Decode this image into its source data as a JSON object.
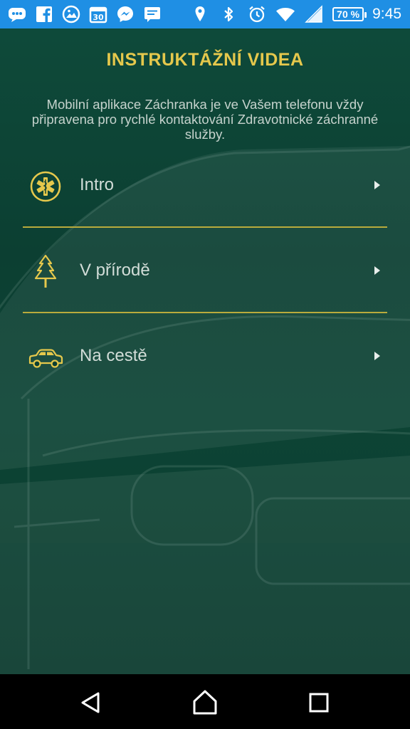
{
  "status_bar": {
    "notification_icons": [
      "chat-bubble-icon",
      "facebook-icon",
      "gallery-icon",
      "calendar-icon",
      "messenger-icon",
      "message-icon"
    ],
    "calendar_day": "30",
    "system_icons": [
      "location-icon",
      "bluetooth-icon",
      "alarm-icon",
      "wifi-icon",
      "signal-icon"
    ],
    "battery": "70 %",
    "time": "9:45"
  },
  "page": {
    "title": "INSTRUKTÁŽNÍ VIDEA",
    "subtitle": "Mobilní aplikace Záchranka je ve Vašem telefonu vždy připravena pro rychlé kontaktování Zdravotnické záchranné služby."
  },
  "menu": {
    "items": [
      {
        "label": "Intro",
        "icon": "star-of-life-icon"
      },
      {
        "label": "V přírodě",
        "icon": "tree-icon"
      },
      {
        "label": "Na cestě",
        "icon": "car-icon"
      }
    ]
  },
  "nav_bar": {
    "buttons": [
      "back-icon",
      "home-icon",
      "recents-icon"
    ]
  },
  "colors": {
    "status_bar": "#1f8fe4",
    "background": "#0c3f32",
    "accent": "#e5c84c",
    "divider": "#b9ab3c",
    "text": "#d2ddd8"
  }
}
